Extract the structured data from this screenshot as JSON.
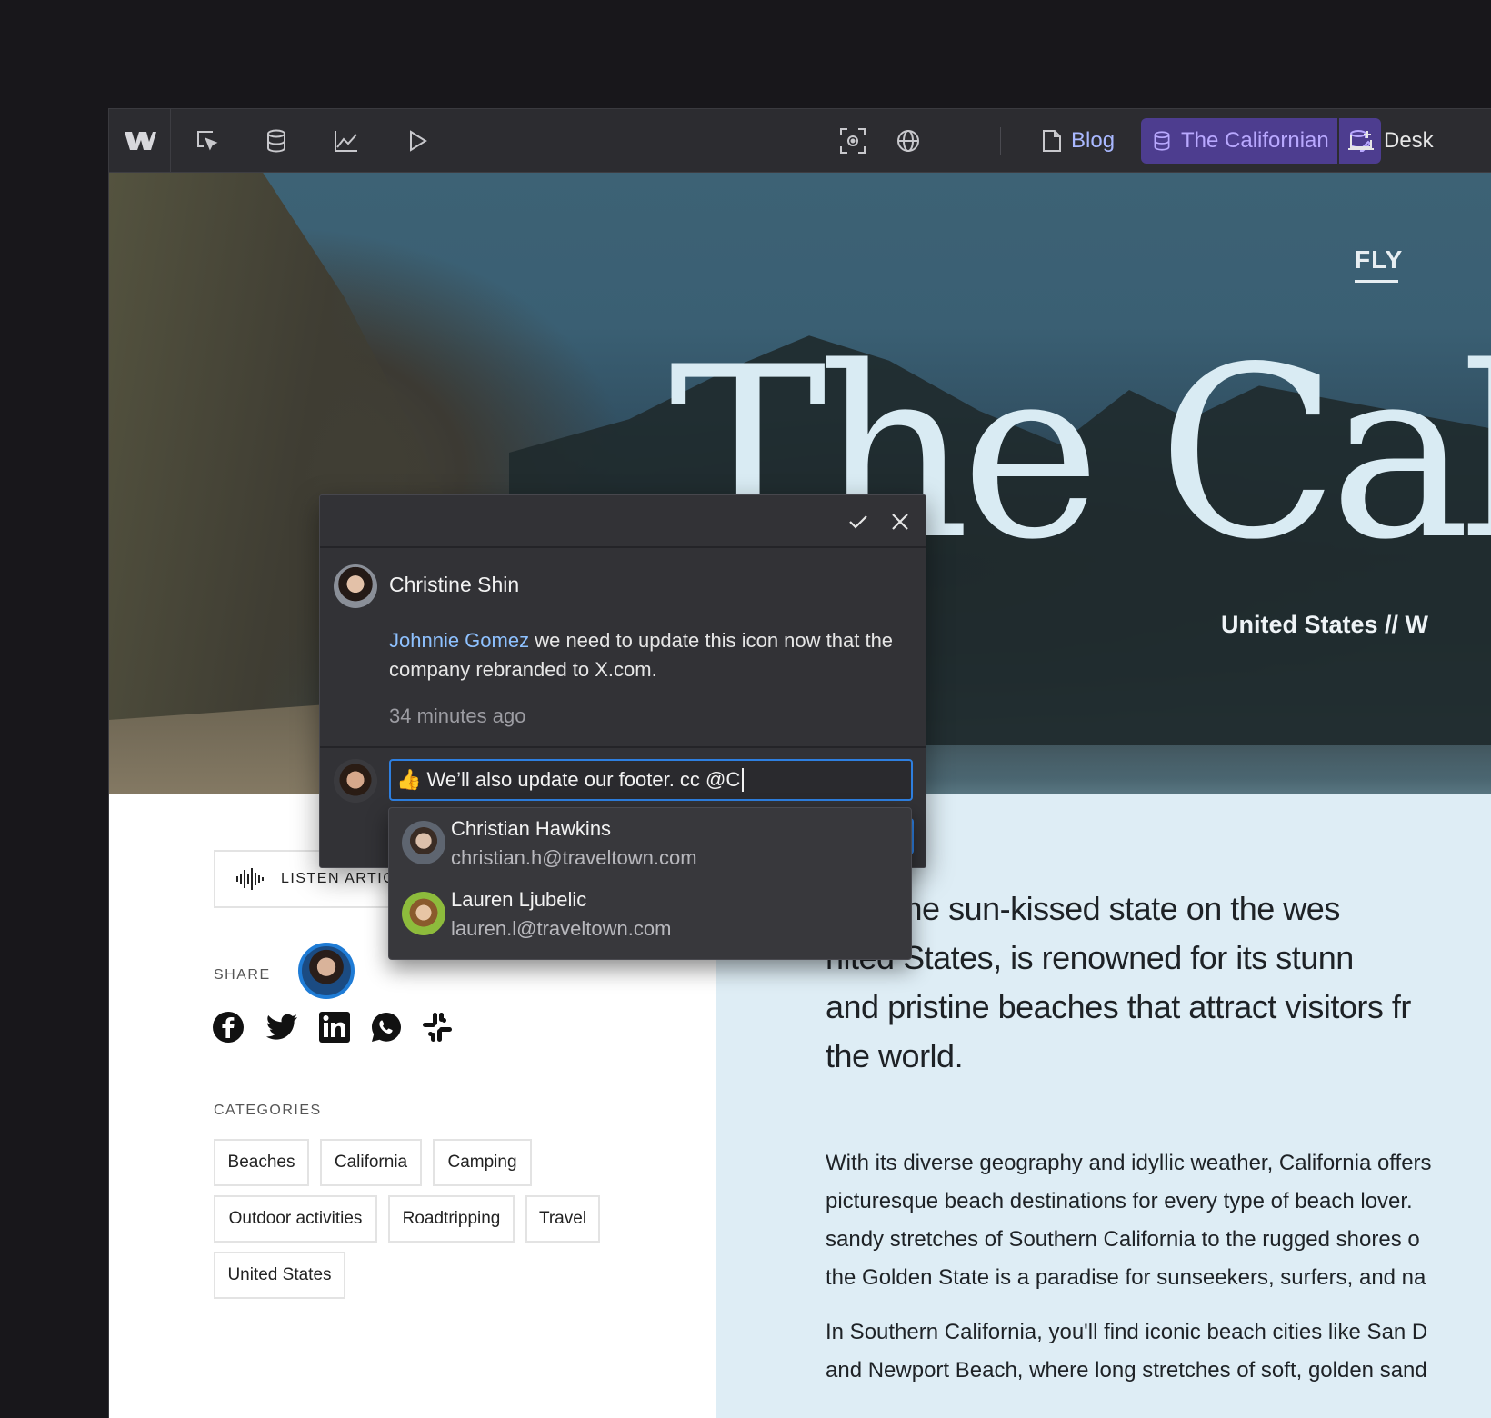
{
  "toolbar": {
    "icons": [
      "webflow-logo",
      "select-icon",
      "cms-icon",
      "analytics-icon",
      "preview-icon",
      "screenshot-icon",
      "globe-icon"
    ],
    "page_label": "Blog",
    "collection_label": "The Californian",
    "breakpoint_label": "Desk",
    "accent_color": "#4d3d8f"
  },
  "hero": {
    "nav_item": "FLY",
    "title": "The Cali",
    "subtitle": "United States // W"
  },
  "sidebar": {
    "listen_label": "LISTEN ARTIC",
    "share_label": "SHARE",
    "social_icons": [
      "facebook-icon",
      "twitter-icon",
      "linkedin-icon",
      "whatsapp-icon",
      "slack-icon"
    ],
    "categories_label": "CATEGORIES",
    "tags": [
      "Beaches",
      "California",
      "Camping",
      "Outdoor activities",
      "Roadtripping",
      "Travel",
      "United States"
    ]
  },
  "article": {
    "lede": "rnia, the sun-kissed state on the wes nited States, is renowned for its stunn and pristine beaches that attract visitors fr the world.",
    "lede_lines": [
      "rnia, the sun-kissed state on the wes",
      "nited States, is renowned for its stunn",
      "and pristine beaches that attract visitors fr",
      "the world."
    ],
    "paragraph1_lines": [
      "With its diverse geography and idyllic weather, California offers",
      "picturesque beach destinations for every type of beach lover.",
      "sandy stretches of Southern California to the rugged shores o",
      "the Golden State is a paradise for sunseekers, surfers, and na"
    ],
    "paragraph2_lines": [
      "In Southern California, you'll find iconic beach cities like San D",
      "and Newport Beach, where long stretches of soft, golden sand"
    ]
  },
  "comment": {
    "author": "Christine Shin",
    "mention": "Johnnie Gomez",
    "text": " we need to update this icon now that the company rebranded to X.com.",
    "time": "34 minutes ago",
    "reply_value": "👍 We’ll also update our footer. cc @C",
    "focus_color": "#2e7fe0"
  },
  "mentions": [
    {
      "name": "Christian Hawkins",
      "email": "christian.h@traveltown.com"
    },
    {
      "name": "Lauren Ljubelic",
      "email": "lauren.l@traveltown.com"
    }
  ]
}
